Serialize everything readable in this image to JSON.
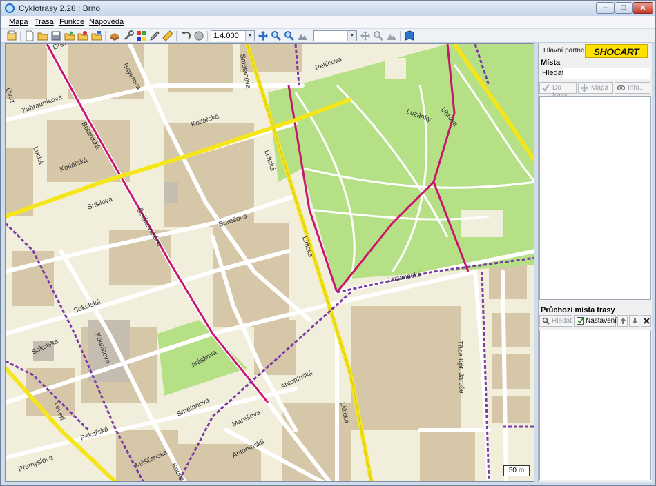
{
  "window": {
    "title": "Cyklotrasy 2.28 : Brno",
    "min_glyph": "–",
    "max_glyph": "□",
    "close_glyph": "✕"
  },
  "menu": {
    "items": [
      "Mapa",
      "Trasa",
      "Funkce",
      "Nápověda"
    ]
  },
  "toolbar": {
    "scale_value": "1:4.000",
    "second_combo_value": "",
    "icons": [
      "new-icon",
      "open-icon",
      "save-icon",
      "export-icon",
      "import-icon",
      "print-icon",
      "atlas-icon",
      "tools-icon",
      "tiles-icon",
      "ruler-icon",
      "pencil-icon",
      "undo-icon",
      "stop-icon",
      "move-icon",
      "zoom-in-icon",
      "zoom-out-icon",
      "route-move-icon",
      "route-zoom-in-icon",
      "route-zoom-out-icon",
      "help-book-icon"
    ]
  },
  "colors": {
    "map_background": "#f1eedb",
    "building": "#d6c7a8",
    "park": "#b5e085",
    "main_road": "#f5e51b",
    "cycle_route": "#c8156e",
    "boundary": "#7b3aa6",
    "street": "#ffffff"
  },
  "map": {
    "scale_label": "50 m",
    "street_labels": [
      "Drevařská",
      "Bayerova",
      "Smetanova",
      "Pellicova",
      "Lidická",
      "Kotlářská",
      "Zahradníkova",
      "Botanická",
      "Lucká",
      "Sušilova",
      "Úvoz",
      "Veveří",
      "Sokolská",
      "Kounicova",
      "Burešova",
      "Čelákovského",
      "Lidická",
      "Lužánecká",
      "Antonínská",
      "Sokolská",
      "Pekařská",
      "Jiráskova",
      "Antonínská",
      "Třída Kpt. Jaroše",
      "Lidická",
      "Kotlářská",
      "Uhrova",
      "Smetanova",
      "Marešova",
      "Přemyslova",
      "Lužánky",
      "Měšťanská",
      "Kounicova"
    ]
  },
  "panel": {
    "partner_label": "Hlavní partner",
    "partner_logo_text": "SHOCART",
    "places_title": "Místa",
    "search_label": "Hledat",
    "search_value": "",
    "btn_route": "Do trasy",
    "btn_map": "Mapa",
    "btn_info": "Info...",
    "via_title": "Průchozí místa trasy",
    "via_search": "Hledat",
    "via_settings": "Nastavení"
  }
}
